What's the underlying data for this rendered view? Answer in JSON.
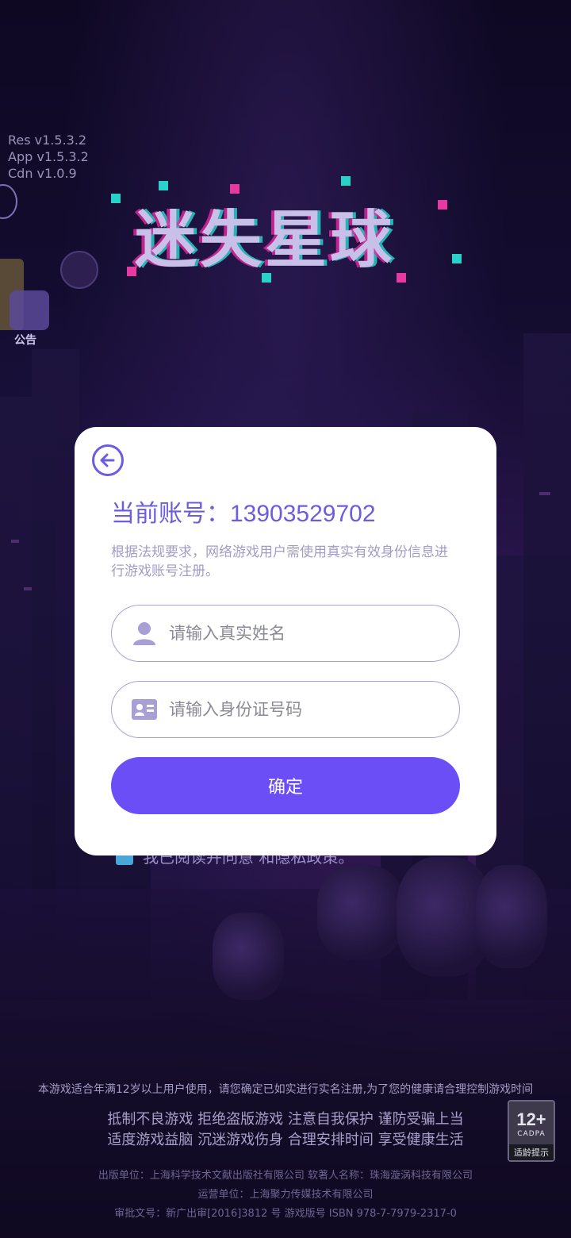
{
  "version": {
    "res": "Res v1.5.3.2",
    "app": "App v1.5.3.2",
    "cdn": "Cdn v1.0.9"
  },
  "game_title": "迷失星球",
  "side": {
    "notice_label": "公告"
  },
  "dialog": {
    "account_label": "当前账号：",
    "account_number": "13903529702",
    "description": "根据法规要求，网络游戏用户需使用真实有效身份信息进行游戏账号注册。",
    "name_placeholder": "请输入真实姓名",
    "id_placeholder": "请输入身份证号码",
    "confirm_label": "确定"
  },
  "agreement": {
    "text": "我已阅读并同意                和隐私政策。"
  },
  "footer": {
    "age_note": "本游戏适合年满12岁以上用户使用，请您确定已如实进行实名注册,为了您的健康请合理控制游戏时间",
    "slogan_1": "抵制不良游戏 拒绝盗版游戏 注意自我保护 谨防受骗上当",
    "slogan_2": "适度游戏益脑 沉迷游戏伤身 合理安排时间 享受健康生活",
    "publisher": "出版单位：上海科学技术文献出版社有限公司 软著人名称：珠海漩涡科技有限公司",
    "operator": "运营单位：上海聚力传媒技术有限公司",
    "approval": "审批文号：新广出审[2016]3812 号        游戏版号 ISBN 978-7-7979-2317-0"
  },
  "age_badge": {
    "age": "12+",
    "org": "CADPA",
    "tip": "适龄提示"
  },
  "colors": {
    "accent": "#6b4ef5",
    "account_text": "#6b5ce0",
    "description_text": "#a39cc7",
    "field_border": "#a9a1d8"
  },
  "icons": {
    "back": "back-arrow-icon",
    "name": "user-icon",
    "id": "id-card-icon"
  }
}
